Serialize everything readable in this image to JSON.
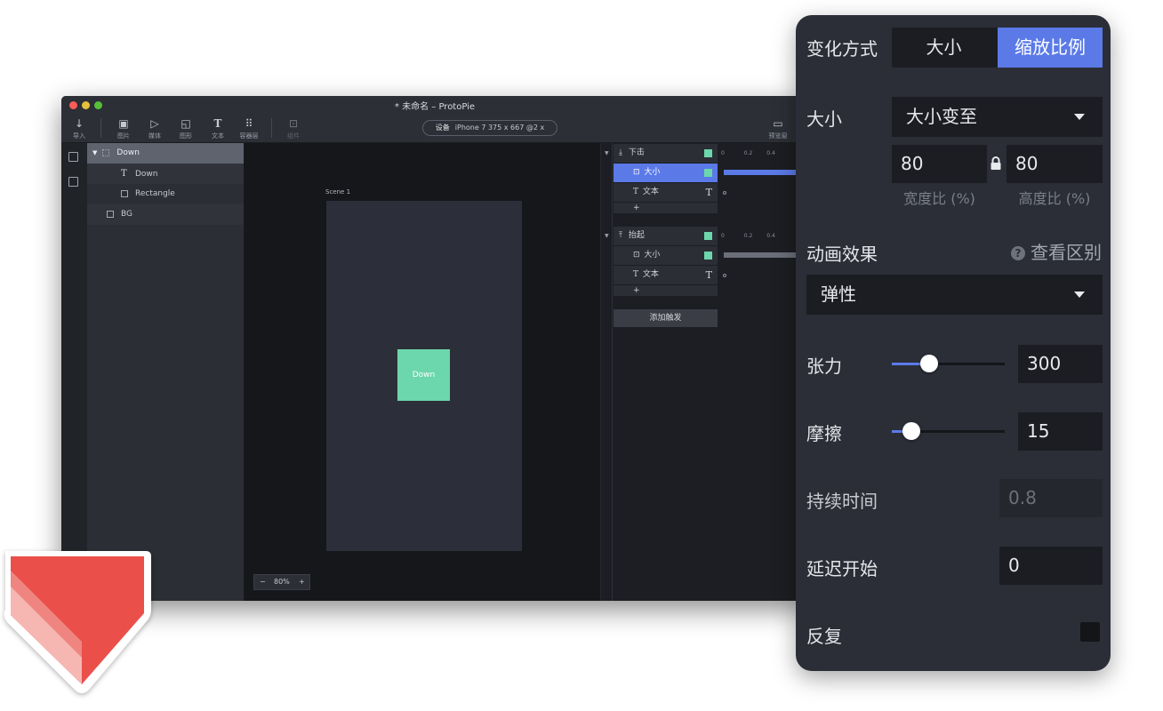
{
  "window": {
    "title": "* 未命名 – ProtoPie",
    "traffic_colors": [
      "#fc5b57",
      "#e5bf3c",
      "#57c038"
    ]
  },
  "toolbar": {
    "import": "导入",
    "image": "图片",
    "media": "媒体",
    "shape": "图形",
    "text": "文本",
    "container": "容器层",
    "component": "组件",
    "preview": "预览窗",
    "device_label": "设备",
    "device_value": "iPhone 7  375 x 667  @2 x"
  },
  "layers": [
    {
      "label": "Down"
    },
    {
      "label": "Down"
    },
    {
      "label": "Rectangle"
    },
    {
      "label": "BG"
    }
  ],
  "canvas": {
    "scene_label": "Scene 1",
    "box_label": "Down",
    "zoom": "80%",
    "zoom_minus": "−",
    "zoom_plus": "+"
  },
  "interactions": {
    "trigger1": "下击",
    "trigger1_size": "大小",
    "trigger1_text": "文本",
    "trigger2": "抬起",
    "trigger2_size": "大小",
    "trigger2_text": "文本",
    "plus": "+",
    "add_trigger": "添加触发",
    "ruler": [
      "0",
      "0.2",
      "0.4"
    ]
  },
  "panel": {
    "change_mode_label": "变化方式",
    "change_mode_options": [
      "大小",
      "缩放比例"
    ],
    "size_label": "大小",
    "size_select": "大小变至",
    "width_ratio": "80",
    "height_ratio": "80",
    "width_caption": "宽度比 (%)",
    "height_caption": "高度比 (%)",
    "animation_label": "动画效果",
    "see_diff": "查看区别",
    "animation_select": "弹性",
    "tension_label": "张力",
    "tension_value": "300",
    "tension_level": 0.33,
    "friction_label": "摩擦",
    "friction_value": "15",
    "friction_level": 0.17,
    "duration_label": "持续时间",
    "duration_value": "0.8",
    "delay_label": "延迟开始",
    "delay_value": "0",
    "repeat_label": "反复"
  },
  "colors": {
    "accent": "#5b7ae8",
    "green": "#6cd6ac",
    "logo": "#ea4f4a"
  }
}
